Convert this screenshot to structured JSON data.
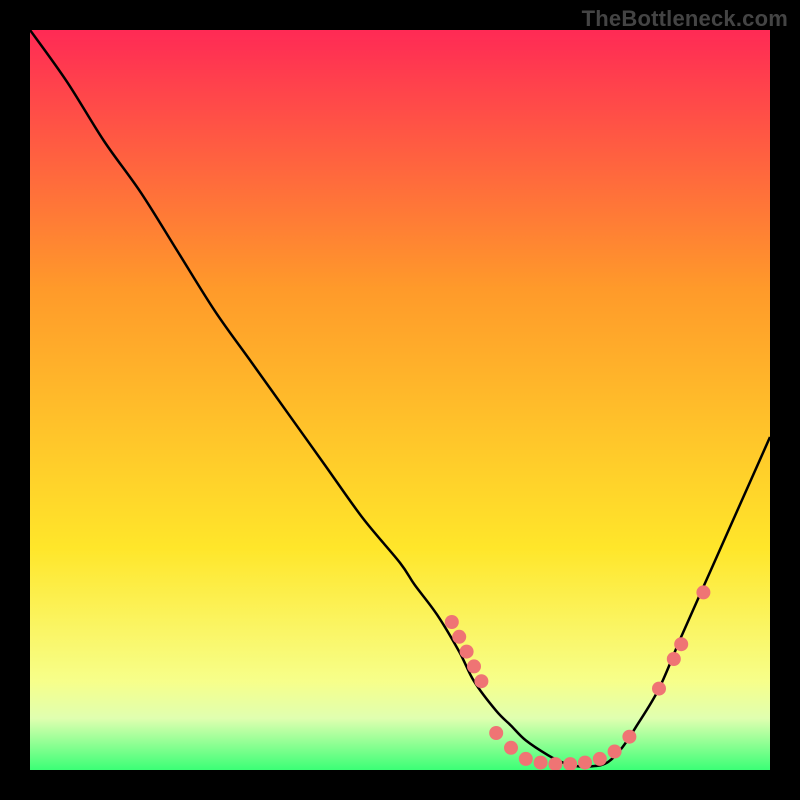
{
  "watermark": "TheBottleneck.com",
  "colors": {
    "black": "#000000",
    "curve": "#000000",
    "dot": "#ef7474",
    "gradient_top": "#ff2a55",
    "gradient_mid1": "#ff9a2a",
    "gradient_mid2": "#ffe62a",
    "gradient_band": "#f7ff8a",
    "gradient_bottom": "#3bff76",
    "watermark": "#444444"
  },
  "chart_data": {
    "type": "line",
    "title": "",
    "xlabel": "",
    "ylabel": "",
    "xlim": [
      0,
      100
    ],
    "ylim": [
      0,
      100
    ],
    "series": [
      {
        "name": "curve",
        "x": [
          0,
          5,
          10,
          15,
          20,
          25,
          30,
          35,
          40,
          45,
          50,
          52,
          55,
          58,
          60,
          63,
          65,
          67,
          70,
          72,
          74,
          76,
          78,
          80,
          82,
          85,
          88,
          92,
          96,
          100
        ],
        "y": [
          100,
          93,
          85,
          78,
          70,
          62,
          55,
          48,
          41,
          34,
          28,
          25,
          21,
          16,
          12,
          8,
          6,
          4,
          2,
          1,
          0.5,
          0.5,
          1,
          3,
          6,
          11,
          18,
          27,
          36,
          45
        ]
      }
    ],
    "markers": [
      {
        "name": "left-cluster-1",
        "x": 57,
        "y": 20
      },
      {
        "name": "left-cluster-2",
        "x": 58,
        "y": 18
      },
      {
        "name": "left-cluster-3",
        "x": 59,
        "y": 16
      },
      {
        "name": "left-cluster-4",
        "x": 60,
        "y": 14
      },
      {
        "name": "left-cluster-5",
        "x": 61,
        "y": 12
      },
      {
        "name": "bottom-1",
        "x": 63,
        "y": 5
      },
      {
        "name": "bottom-2",
        "x": 65,
        "y": 3
      },
      {
        "name": "bottom-3",
        "x": 67,
        "y": 1.5
      },
      {
        "name": "bottom-4",
        "x": 69,
        "y": 1
      },
      {
        "name": "bottom-5",
        "x": 71,
        "y": 0.8
      },
      {
        "name": "bottom-6",
        "x": 73,
        "y": 0.8
      },
      {
        "name": "bottom-7",
        "x": 75,
        "y": 1
      },
      {
        "name": "bottom-8",
        "x": 77,
        "y": 1.5
      },
      {
        "name": "bottom-9",
        "x": 79,
        "y": 2.5
      },
      {
        "name": "bottom-10",
        "x": 81,
        "y": 4.5
      },
      {
        "name": "right-1",
        "x": 85,
        "y": 11
      },
      {
        "name": "right-2",
        "x": 87,
        "y": 15
      },
      {
        "name": "right-3",
        "x": 88,
        "y": 17
      },
      {
        "name": "right-4",
        "x": 91,
        "y": 24
      }
    ],
    "gradient_stops": [
      {
        "offset": 0.0,
        "color": "#ff2a55"
      },
      {
        "offset": 0.35,
        "color": "#ff9a2a"
      },
      {
        "offset": 0.7,
        "color": "#ffe62a"
      },
      {
        "offset": 0.88,
        "color": "#f7ff8a"
      },
      {
        "offset": 0.93,
        "color": "#e0ffb0"
      },
      {
        "offset": 1.0,
        "color": "#3bff76"
      }
    ]
  }
}
